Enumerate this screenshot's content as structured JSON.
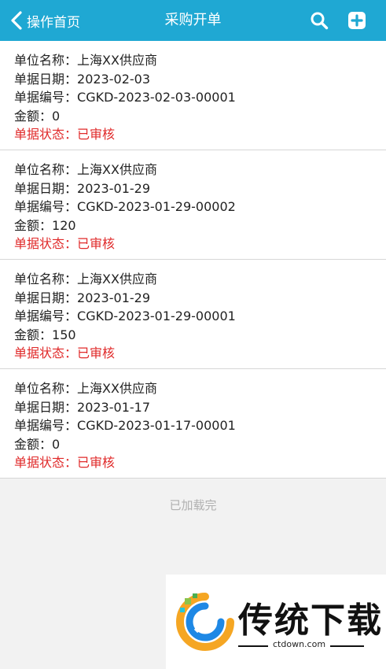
{
  "header": {
    "back_label": "操作首页",
    "title": "采购开单",
    "search_icon": "search-icon",
    "add_icon": "plus-square-icon",
    "bg_color": "#1fa8d3"
  },
  "labels": {
    "unit": "单位名称：",
    "date": "单据日期：",
    "code": "单据编号：",
    "amount": "金额：",
    "status": "单据状态："
  },
  "records": [
    {
      "unit": "上海XX供应商",
      "date": "2023-02-03",
      "code": "CGKD-2023-02-03-00001",
      "amount": "0",
      "status": "已审核"
    },
    {
      "unit": "上海XX供应商",
      "date": "2023-01-29",
      "code": "CGKD-2023-01-29-00002",
      "amount": "120",
      "status": "已审核"
    },
    {
      "unit": "上海XX供应商",
      "date": "2023-01-29",
      "code": "CGKD-2023-01-29-00001",
      "amount": "150",
      "status": "已审核"
    },
    {
      "unit": "上海XX供应商",
      "date": "2023-01-17",
      "code": "CGKD-2023-01-17-00001",
      "amount": "0",
      "status": "已审核"
    }
  ],
  "footer": {
    "load_status": "已加载完"
  },
  "watermark": {
    "text": "传统下载",
    "url": "ctdown.com"
  },
  "colors": {
    "status_red": "#e02a2a"
  }
}
